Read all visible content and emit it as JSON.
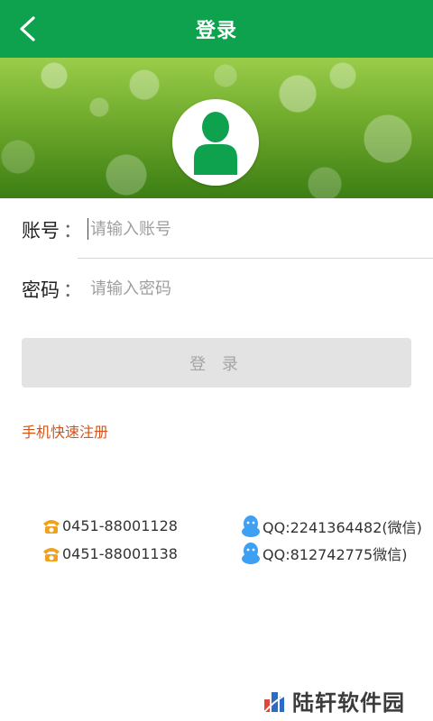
{
  "header": {
    "title": "登录"
  },
  "form": {
    "account": {
      "label": "账号",
      "colon": "：",
      "placeholder": "请输入账号"
    },
    "password": {
      "label": "密码",
      "colon": "：",
      "placeholder": "请输入密码"
    },
    "login_button": "登 录",
    "register_link": "手机快速注册"
  },
  "contacts": {
    "phones": [
      "0451-88001128",
      "0451-88001138"
    ],
    "qq": [
      "QQ:2241364482(微信)",
      "QQ:812742775微信)"
    ]
  },
  "watermark": {
    "text": "陆轩软件园"
  },
  "colors": {
    "primary": "#0ea24f",
    "register_link": "#d2551b",
    "phone_icon": "#f2a11e",
    "qq_icon": "#3da0f2"
  }
}
